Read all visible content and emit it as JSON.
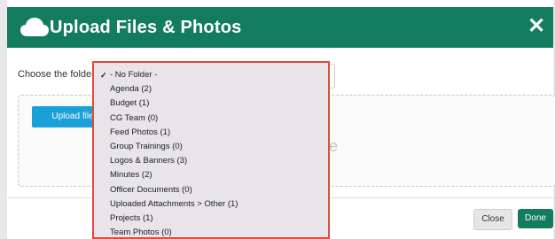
{
  "dialog": {
    "title": "Upload Files & Photos",
    "close_symbol": "✕",
    "icon": "cloud-icon",
    "header_color": "#137c5f"
  },
  "folder": {
    "label": "Choose the folder:",
    "selected": "- No Folder -",
    "options": [
      "- No Folder -",
      "Agenda (2)",
      "Budget (1)",
      "CG Team (0)",
      "Feed Photos (1)",
      "Group Trainings (0)",
      "Logos & Banners (3)",
      "Minutes (2)",
      "Officer Documents (0)",
      "Uploaded Attachments > Other (1)",
      "Projects (1)",
      "Team Photos (0)"
    ]
  },
  "upload": {
    "button_label": "Upload file",
    "drop_text_fragment": "re",
    "button_color": "#1a9fd6"
  },
  "footer": {
    "close_label": "Close",
    "done_label": "Done"
  },
  "highlight_color": "#e24a3a"
}
